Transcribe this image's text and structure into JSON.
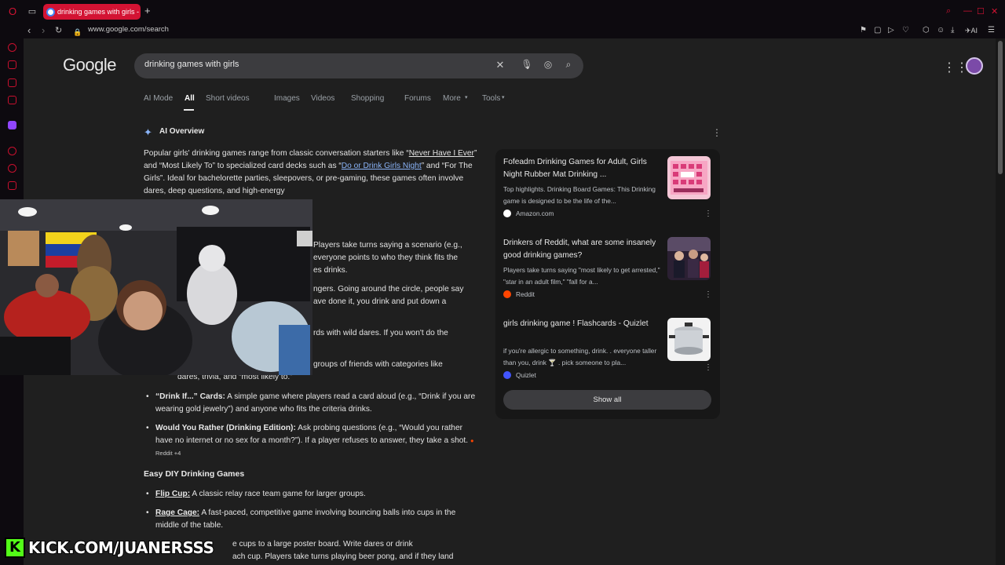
{
  "browser": {
    "tab_title": "drinking games with girls -",
    "url": "www.google.com/search"
  },
  "google": {
    "query": "drinking games with girls",
    "tabs": [
      "AI Mode",
      "All",
      "Short videos",
      "Images",
      "Videos",
      "Shopping",
      "Forums",
      "More",
      "Tools"
    ],
    "active_tab": "All"
  },
  "ai_overview": {
    "heading": "AI Overview",
    "intro_1": "Popular girls' drinking games range from classic conversation starters like “",
    "link_1": "Never Have I Ever",
    "intro_2": "” and “Most Likely To” to specialized card decks such as “",
    "link_2": "Do or Drink Girls Night",
    "intro_3": "” and “For The Girls”. Ideal for bachelorette parties, sleepovers, or pre-gaming, these games often involve dares, deep questions, and high-energy",
    "partial_lines": [
      "Players take turns saying a scenario (e.g.,",
      "everyone points to who they think fits the",
      "es drinks.",
      "ngers. Going around the circle, people say",
      "ave done it, you drink and put down a",
      "rds with wild dares. If you won't do the",
      "groups of friends with categories like",
      "dares, trivia, and “most likely to.”"
    ],
    "bullets": [
      {
        "title": "“Drink If...” Cards:",
        "text": " A simple game where players read a card aloud (e.g., “Drink if you are wearing gold jewelry”) and anyone who fits the criteria drinks."
      },
      {
        "title": "Would You Rather (Drinking Edition):",
        "text": " Ask probing questions (e.g., “Would you rather have no internet or no sex for a month?”). If a player refuses to answer, they take a shot.",
        "chip": "Reddit +4"
      }
    ],
    "section_heading": "Easy DIY Drinking Games",
    "diy_bullets": [
      {
        "title": "Flip Cup:",
        "text": " A classic relay race team game for larger groups."
      },
      {
        "title": "Rage Cage:",
        "text": " A fast-paced, competitive game involving bouncing balls into cups in the middle of the table."
      }
    ],
    "partial_bottom": [
      "e cups to a large poster board. Write dares or drink",
      "ach cup. Players take turns playing beer pong, and if they land"
    ]
  },
  "sources": [
    {
      "title": "Fofeadm Drinking Games for Adult, Girls Night Rubber Mat Drinking ...",
      "snippet": "Top highlights. Drinking Board Games: This Drinking game is designed to be the life of the...",
      "site": "Amazon.com",
      "icon_color": "#ffffff"
    },
    {
      "title": "Drinkers of Reddit, what are some insanely good drinking games?",
      "snippet": "Players take turns saying \"most likely to get arrested,\" \"star in an adult film,\" \"fall for a...",
      "site": "Reddit",
      "icon_color": "#ff4500"
    },
    {
      "title": "girls drinking game ! Flashcards - Quizlet",
      "snippet": "if you're allergic to something, drink. . everyone taller than you, drink 🍸 . pick someone to pla...",
      "site": "Quizlet",
      "icon_color": "#4255ff"
    }
  ],
  "show_all": "Show all",
  "overlay": {
    "watermark": "KICK.COM/JUANERSSS",
    "watermark_logo": "K"
  }
}
